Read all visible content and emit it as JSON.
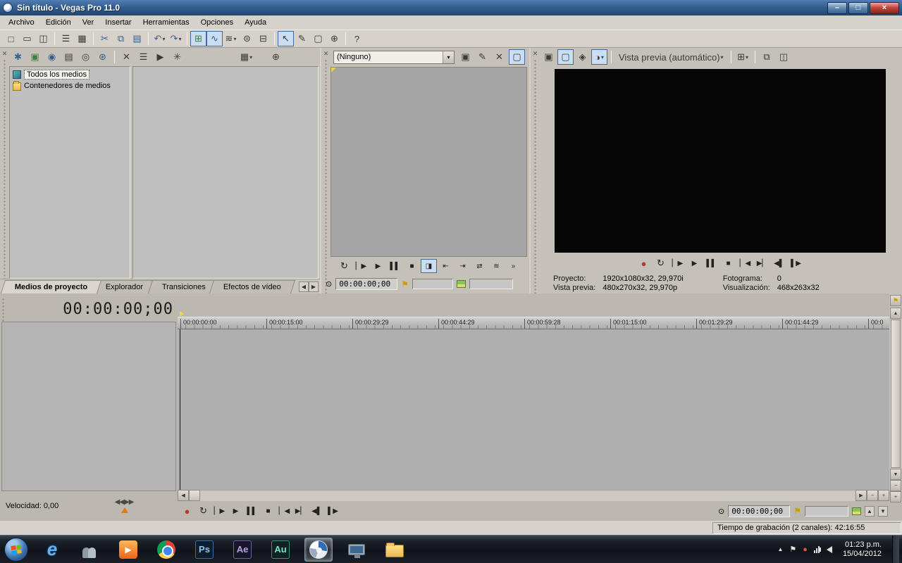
{
  "window": {
    "title": "Sin título - Vegas Pro 11.0",
    "minimize": "–",
    "maximize": "□",
    "close": "×"
  },
  "menu": {
    "items": [
      "Archivo",
      "Edición",
      "Ver",
      "Insertar",
      "Herramientas",
      "Opciones",
      "Ayuda"
    ]
  },
  "icons": {
    "dropdown": "▾",
    "record": "●",
    "loop": "↻",
    "play_from_start": "▏▶",
    "play": "▶",
    "pause": "▌▌",
    "stop": "■",
    "go_to_start": "▏◀",
    "go_to_end": "▶▏",
    "prev_frame": "◀▌",
    "next_frame": "▌▶",
    "overflow": "»",
    "close": "✕",
    "search": "⊕",
    "flag": "⚑",
    "position": "⊙",
    "left": "◀",
    "right": "▶",
    "up": "▲",
    "down": "▼",
    "minus": "−",
    "plus": "+",
    "frame_select": "◨",
    "marker_prev": "⇤",
    "marker_next": "⇥",
    "swap": "⇄",
    "audio": "≋",
    "grid": "⊞",
    "copy": "⧉",
    "save": "◫",
    "monitor": "▢",
    "fx": "◈",
    "split": "◑",
    "clapper": "▣",
    "pen": "✎",
    "marker_tool": "⚑"
  },
  "main_toolbar": {
    "buttons": [
      {
        "name": "new-project",
        "glyph": "□"
      },
      {
        "name": "open-project",
        "glyph": "▭"
      },
      {
        "name": "save-project",
        "glyph": "◫"
      },
      {
        "name": "project-properties",
        "glyph": "☰"
      },
      {
        "name": "render-as",
        "glyph": "▦"
      },
      {
        "name": "cut",
        "glyph": "✂"
      },
      {
        "name": "copy",
        "glyph": "⧉"
      },
      {
        "name": "paste",
        "glyph": "▤"
      },
      {
        "name": "undo",
        "glyph": "↶"
      },
      {
        "name": "redo",
        "glyph": "↷"
      },
      {
        "name": "enable-snapping",
        "glyph": "⊞"
      },
      {
        "name": "automatic-crossfades",
        "glyph": "∿"
      },
      {
        "name": "auto-ripple",
        "glyph": "≋"
      },
      {
        "name": "lock-envelopes",
        "glyph": "⊜"
      },
      {
        "name": "ignore-event-grouping",
        "glyph": "⊟"
      },
      {
        "name": "normal-edit-tool",
        "glyph": "↖"
      },
      {
        "name": "envelope-edit-tool",
        "glyph": "✎"
      },
      {
        "name": "selection-edit-tool",
        "glyph": "▢"
      },
      {
        "name": "zoom-edit-tool",
        "glyph": "⊕"
      },
      {
        "name": "whats-this-help",
        "glyph": "?"
      }
    ]
  },
  "media_panel": {
    "toolbar": [
      {
        "name": "media-generators",
        "glyph": "✱"
      },
      {
        "name": "import-media",
        "glyph": "▣"
      },
      {
        "name": "capture-video",
        "glyph": "◉"
      },
      {
        "name": "get-photo",
        "glyph": "▤"
      },
      {
        "name": "extract-audio-from-cd",
        "glyph": "◎"
      },
      {
        "name": "get-media-from-web",
        "glyph": "⊛"
      },
      {
        "name": "remove-media",
        "glyph": "✕"
      },
      {
        "name": "media-properties",
        "glyph": "☰"
      },
      {
        "name": "start-preview",
        "glyph": "▶"
      },
      {
        "name": "auto-preview",
        "glyph": "✳"
      },
      {
        "name": "views",
        "glyph": "▦"
      },
      {
        "name": "search-media",
        "glyph": "⊕"
      }
    ],
    "tree": [
      {
        "label": "Todos los medios"
      },
      {
        "label": "Contenedores de medios"
      }
    ],
    "tabs": [
      "Medios de proyecto",
      "Explorador",
      "Transiciones",
      "Efectos de vídeo"
    ]
  },
  "trimmer": {
    "plugin": "(Ninguno)",
    "toolbar": [
      {
        "name": "add-to-project-media",
        "glyph": "▣"
      },
      {
        "name": "save-markers",
        "glyph": "✎"
      },
      {
        "name": "remove-subclip",
        "glyph": "✕"
      },
      {
        "name": "show-video-monitor",
        "glyph": "▢"
      }
    ],
    "timecode": "00:00:00;00"
  },
  "preview": {
    "toolbar": [
      {
        "name": "project-video-properties",
        "glyph": "▣"
      },
      {
        "name": "preview-on-external-monitor",
        "glyph": "▢"
      },
      {
        "name": "video-output-fx",
        "glyph": "◈"
      },
      {
        "name": "split-screen-view",
        "glyph": "◑"
      }
    ],
    "quality": "Vista previa (automático)",
    "toolbar_right": [
      {
        "name": "overlays-grid",
        "glyph": "⊞"
      },
      {
        "name": "copy-snapshot",
        "glyph": "⧉"
      },
      {
        "name": "save-snapshot",
        "glyph": "◫"
      }
    ],
    "info": {
      "project_label": "Proyecto:",
      "project_value": "1920x1080x32, 29,970i",
      "frame_label": "Fotograma:",
      "frame_value": "0",
      "preview_label": "Vista previa:",
      "preview_value": "480x270x32, 29,970p",
      "display_label": "Visualización:",
      "display_value": "468x263x32"
    }
  },
  "timeline": {
    "big_timecode": "00:00:00;00",
    "ruler": [
      "00:00:00:00",
      "00:00:15:00",
      "00:00:29:29",
      "00:00:44:29",
      "00:00:59:28",
      "00:01:15:00",
      "00:01:29:29",
      "00:01:44:29",
      "00:0"
    ],
    "rate_label": "Velocidad: 0,00",
    "timecode": "00:00:00;00"
  },
  "status": {
    "record_time": "Tiempo de grabación (2 canales): 42:16:55"
  },
  "taskbar": {
    "ie": "e",
    "ps": "Ps",
    "ae": "Ae",
    "au": "Au",
    "clock_time": "01:23 p.m.",
    "clock_date": "15/04/2012"
  }
}
